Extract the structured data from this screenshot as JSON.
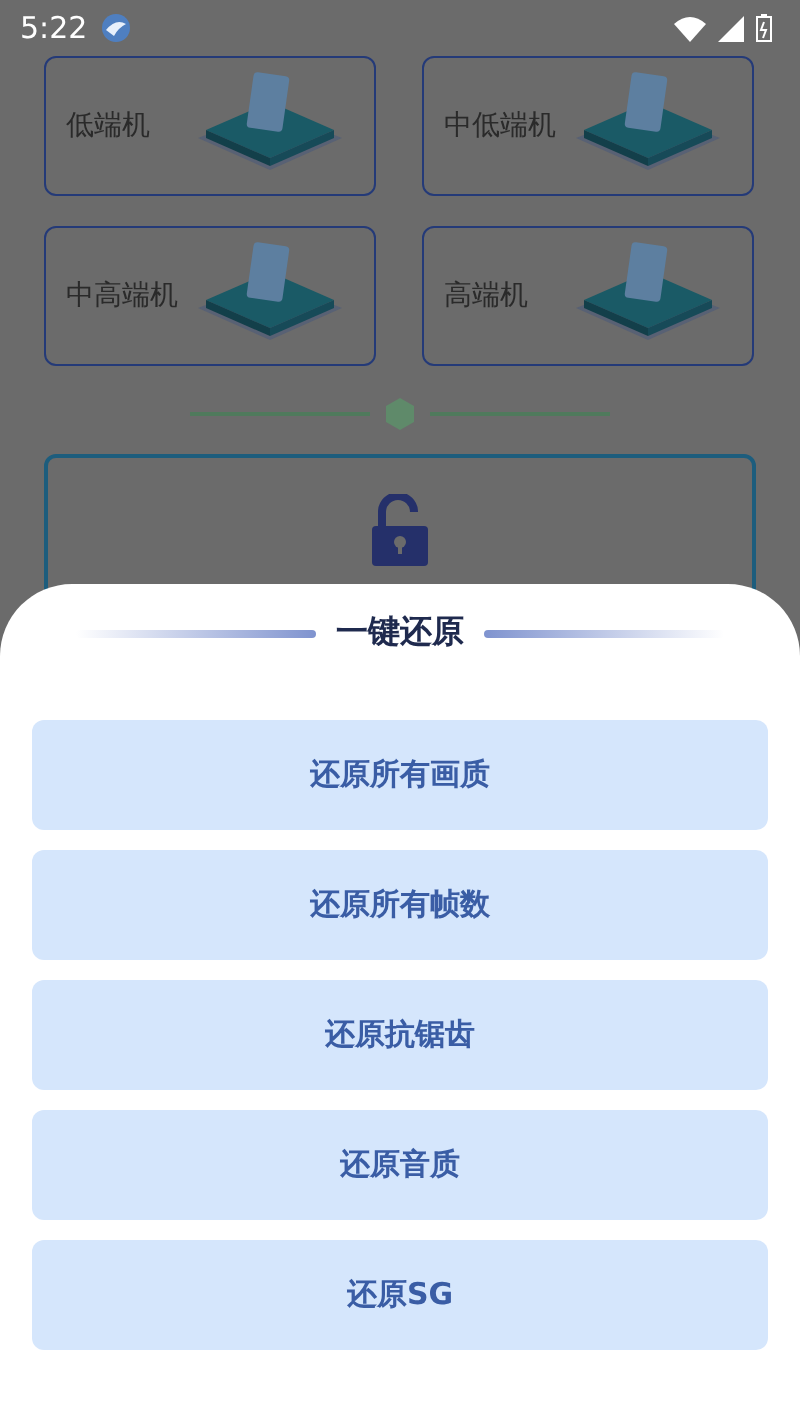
{
  "status_bar": {
    "time": "5:22"
  },
  "device_tiers": [
    {
      "label": "低端机"
    },
    {
      "label": "中低端机"
    },
    {
      "label": "中高端机"
    },
    {
      "label": "高端机"
    }
  ],
  "sheet": {
    "title": "一键还原",
    "buttons": [
      {
        "label": "还原所有画质"
      },
      {
        "label": "还原所有帧数"
      },
      {
        "label": "还原抗锯齿"
      },
      {
        "label": "还原音质"
      },
      {
        "label": "还原SG"
      }
    ]
  }
}
